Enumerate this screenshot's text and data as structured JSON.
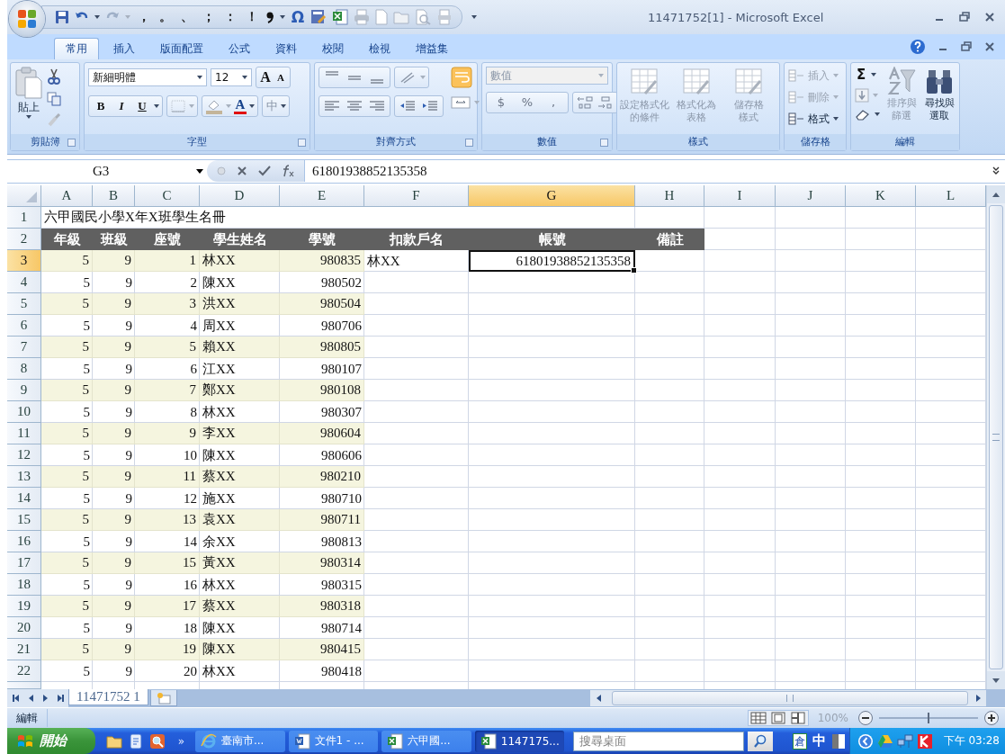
{
  "title_bar": {
    "quick_access": [
      "，",
      "。",
      "、",
      "；",
      "：",
      "！"
    ],
    "symbol": "Ω",
    "title": "11471752[1] - Microsoft Excel"
  },
  "tabs": [
    {
      "label": "常用",
      "selected": true
    },
    {
      "label": "插入",
      "selected": false
    },
    {
      "label": "版面配置",
      "selected": false
    },
    {
      "label": "公式",
      "selected": false
    },
    {
      "label": "資料",
      "selected": false
    },
    {
      "label": "校閱",
      "selected": false
    },
    {
      "label": "檢視",
      "selected": false
    },
    {
      "label": "增益集",
      "selected": false
    }
  ],
  "ribbon": {
    "clipboard": {
      "paste": "貼上",
      "label": "剪貼簿"
    },
    "font": {
      "name": "新細明體",
      "size": "12",
      "grow": "A",
      "shrink": "A",
      "styles": [
        "B",
        "I",
        "U"
      ],
      "color_letter": "A",
      "phonetic": "中",
      "label": "字型"
    },
    "alignment": {
      "label": "對齊方式"
    },
    "number": {
      "format": "數值",
      "format_disabled": true,
      "symbols": [
        "$",
        "%",
        ","
      ],
      "label": "數值"
    },
    "styles": {
      "buttons": [
        {
          "lines": [
            "設定格式化",
            "的條件"
          ],
          "disabled": true
        },
        {
          "lines": [
            "格式化為",
            "表格"
          ],
          "disabled": true
        },
        {
          "lines": [
            "儲存格",
            "樣式"
          ],
          "disabled": true
        }
      ],
      "label": "樣式"
    },
    "cells": {
      "buttons": [
        {
          "label": "插入",
          "disabled": true
        },
        {
          "label": "刪除",
          "disabled": true
        },
        {
          "label": "格式",
          "disabled": false
        }
      ],
      "label": "儲存格"
    },
    "editing": {
      "autosum": "Σ",
      "buttons": [
        {
          "lines": [
            "排序與",
            "篩選"
          ],
          "disabled": true
        },
        {
          "lines": [
            "尋找與",
            "選取"
          ],
          "disabled": false
        }
      ],
      "label": "編輯"
    }
  },
  "formula_bar": {
    "name_box": "G3",
    "value": "61801938852135358"
  },
  "sheet": {
    "columns": [
      {
        "label": "A",
        "selected": false
      },
      {
        "label": "B",
        "selected": false
      },
      {
        "label": "C",
        "selected": false
      },
      {
        "label": "D",
        "selected": false
      },
      {
        "label": "E",
        "selected": false
      },
      {
        "label": "F",
        "selected": false
      },
      {
        "label": "G",
        "selected": true
      },
      {
        "label": "H",
        "selected": false
      },
      {
        "label": "I",
        "selected": false
      },
      {
        "label": "J",
        "selected": false
      },
      {
        "label": "K",
        "selected": false
      },
      {
        "label": "L",
        "selected": false
      }
    ],
    "title_row": {
      "number": "1",
      "text": "六甲國民小學X年X班學生名冊"
    },
    "header_row": {
      "number": "2",
      "headers": [
        "年級",
        "班級",
        "座號",
        "學生姓名",
        "學號",
        "扣款戶名",
        "帳號",
        "備註"
      ]
    },
    "rows": [
      {
        "number": "3",
        "selected": true,
        "shaded": true,
        "grade": "5",
        "class": "9",
        "seat": "1",
        "name": "林XX",
        "student_id": "980835",
        "payer": "林XX",
        "account": "61801938852135358"
      },
      {
        "number": "4",
        "selected": false,
        "shaded": false,
        "grade": "5",
        "class": "9",
        "seat": "2",
        "name": "陳XX",
        "student_id": "980502"
      },
      {
        "number": "5",
        "selected": false,
        "shaded": true,
        "grade": "5",
        "class": "9",
        "seat": "3",
        "name": "洪XX",
        "student_id": "980504"
      },
      {
        "number": "6",
        "selected": false,
        "shaded": false,
        "grade": "5",
        "class": "9",
        "seat": "4",
        "name": "周XX",
        "student_id": "980706"
      },
      {
        "number": "7",
        "selected": false,
        "shaded": true,
        "grade": "5",
        "class": "9",
        "seat": "5",
        "name": "賴XX",
        "student_id": "980805"
      },
      {
        "number": "8",
        "selected": false,
        "shaded": false,
        "grade": "5",
        "class": "9",
        "seat": "6",
        "name": "江XX",
        "student_id": "980107"
      },
      {
        "number": "9",
        "selected": false,
        "shaded": true,
        "grade": "5",
        "class": "9",
        "seat": "7",
        "name": "鄭XX",
        "student_id": "980108"
      },
      {
        "number": "10",
        "selected": false,
        "shaded": false,
        "grade": "5",
        "class": "9",
        "seat": "8",
        "name": "林XX",
        "student_id": "980307"
      },
      {
        "number": "11",
        "selected": false,
        "shaded": true,
        "grade": "5",
        "class": "9",
        "seat": "9",
        "name": "李XX",
        "student_id": "980604"
      },
      {
        "number": "12",
        "selected": false,
        "shaded": false,
        "grade": "5",
        "class": "9",
        "seat": "10",
        "name": "陳XX",
        "student_id": "980606"
      },
      {
        "number": "13",
        "selected": false,
        "shaded": true,
        "grade": "5",
        "class": "9",
        "seat": "11",
        "name": "蔡XX",
        "student_id": "980210"
      },
      {
        "number": "14",
        "selected": false,
        "shaded": false,
        "grade": "5",
        "class": "9",
        "seat": "12",
        "name": "施XX",
        "student_id": "980710"
      },
      {
        "number": "15",
        "selected": false,
        "shaded": true,
        "grade": "5",
        "class": "9",
        "seat": "13",
        "name": "袁XX",
        "student_id": "980711"
      },
      {
        "number": "16",
        "selected": false,
        "shaded": false,
        "grade": "5",
        "class": "9",
        "seat": "14",
        "name": "余XX",
        "student_id": "980813"
      },
      {
        "number": "17",
        "selected": false,
        "shaded": true,
        "grade": "5",
        "class": "9",
        "seat": "15",
        "name": "黃XX",
        "student_id": "980314"
      },
      {
        "number": "18",
        "selected": false,
        "shaded": false,
        "grade": "5",
        "class": "9",
        "seat": "16",
        "name": "林XX",
        "student_id": "980315"
      },
      {
        "number": "19",
        "selected": false,
        "shaded": true,
        "grade": "5",
        "class": "9",
        "seat": "17",
        "name": "蔡XX",
        "student_id": "980318"
      },
      {
        "number": "20",
        "selected": false,
        "shaded": false,
        "grade": "5",
        "class": "9",
        "seat": "18",
        "name": "陳XX",
        "student_id": "980714"
      },
      {
        "number": "21",
        "selected": false,
        "shaded": true,
        "grade": "5",
        "class": "9",
        "seat": "19",
        "name": "陳XX",
        "student_id": "980415"
      },
      {
        "number": "22",
        "selected": false,
        "shaded": false,
        "grade": "5",
        "class": "9",
        "seat": "20",
        "name": "林XX",
        "student_id": "980418"
      }
    ]
  },
  "sheet_tabs": [
    {
      "label": "11471752 1",
      "selected": true
    }
  ],
  "status_bar": {
    "mode": "編輯",
    "zoom": "100%",
    "zoom_slider": {
      "level": 0.5
    }
  },
  "taskbar": {
    "start": "開始",
    "more": "»",
    "tasks": [
      {
        "label": "臺南市...",
        "kind": "browser",
        "selected": false
      },
      {
        "label": "文件1 - ...",
        "kind": "word",
        "selected": false
      },
      {
        "label": "六甲國...",
        "kind": "excel",
        "selected": false
      },
      {
        "label": "1147175...",
        "kind": "excel",
        "selected": true
      }
    ],
    "search": {
      "placeholder": "搜尋桌面"
    },
    "ime": [
      "倉",
      "中"
    ],
    "clock": "下午 03:28"
  }
}
